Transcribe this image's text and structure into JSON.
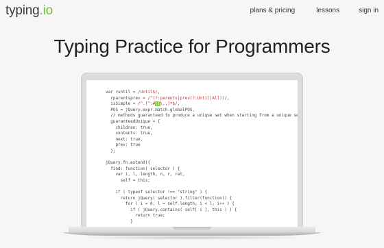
{
  "header": {
    "logo_main": "typing",
    "logo_dot": ".",
    "logo_tld": "io",
    "nav": [
      "plans & pricing",
      "lessons",
      "sign in"
    ]
  },
  "headline": "Typing Practice for Programmers",
  "code_lines": [
    "var runtil = /Until$/,",
    "  rparentsprev = /^(?:parents|prev(?:Until|All))/,",
    "  isSimple = /^.[^:#\\[\\.,]*$/,",
    "  POS = jQuery.expr.match.globalPOS,",
    "  // methods guaranteed to produce a unique set when starting from a unique set",
    "  guaranteedUnique = {",
    "    children: true,",
    "    contents: true,",
    "    next: true,",
    "    prev: true",
    "  };",
    "",
    "jQuery.fn.extend({",
    "  find: function( selector ) {",
    "    var i, l, length, n, r, ret,",
    "      self = this;",
    "",
    "    if ( typeof selector !== \"string\" ) {",
    "      return jQuery( selector ).filter(function() {",
    "        for ( i = 0, l = self.length; i < l; i++ ) {",
    "          if ( jQuery.contains( self[ i ], this ) ) {",
    "            return true;",
    "          }"
  ],
  "colors": {
    "accent": "#6fbf3b",
    "cursor": "#8bc34a",
    "regex": "#bb3333"
  }
}
